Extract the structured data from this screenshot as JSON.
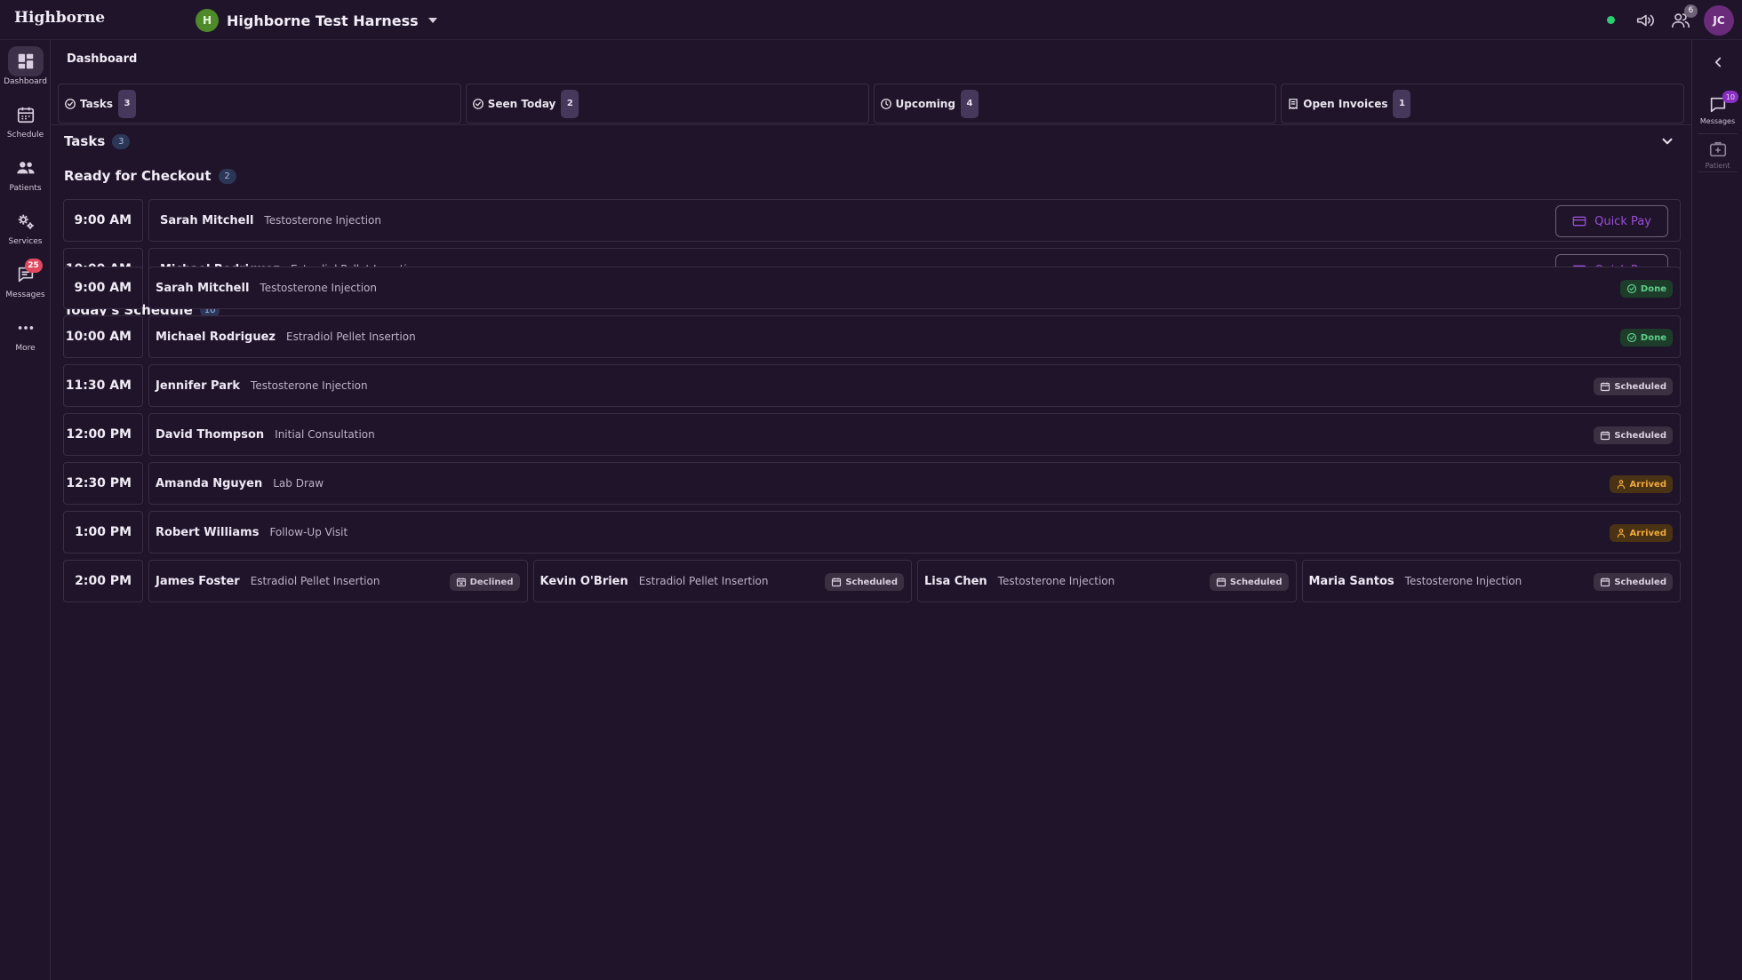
{
  "app": {
    "brand": "Highborne",
    "org_initial": "H",
    "org_name": "Highborne Test Harness",
    "user_initials": "JC",
    "notification_count": "6",
    "status_color": "#2ecc71",
    "accent_color": "#9a4fd6"
  },
  "sidebar": {
    "items": [
      {
        "label": "Dashboard",
        "icon": "dashboard-icon",
        "active": true
      },
      {
        "label": "Schedule",
        "icon": "calendar-icon"
      },
      {
        "label": "Patients",
        "icon": "users-icon"
      },
      {
        "label": "Services",
        "icon": "gears-icon"
      },
      {
        "label": "Messages",
        "icon": "chat-icon",
        "badge": "25"
      },
      {
        "label": "More",
        "icon": "more-icon"
      }
    ]
  },
  "right_rail": {
    "items": [
      {
        "label": "Messages",
        "icon": "chat-icon",
        "badge": "10"
      },
      {
        "label": "Patient",
        "icon": "patient-icon"
      }
    ]
  },
  "page": {
    "title": "Dashboard"
  },
  "stat_tabs": [
    {
      "label": "Tasks",
      "count": "3",
      "icon": "check-circle-icon"
    },
    {
      "label": "Seen Today",
      "count": "2",
      "icon": "check-circle-icon"
    },
    {
      "label": "Upcoming",
      "count": "4",
      "icon": "clock-icon"
    },
    {
      "label": "Open Invoices",
      "count": "1",
      "icon": "invoice-icon"
    }
  ],
  "tasks": {
    "title": "Tasks",
    "count": "3",
    "checkout": {
      "title": "Ready for Checkout",
      "count": "2",
      "button_label": "Quick Pay",
      "rows": [
        {
          "time": "9:00 AM",
          "name": "Sarah Mitchell",
          "service": "Testosterone Injection"
        },
        {
          "time": "10:00 AM",
          "name": "Michael Rodriguez",
          "service": "Estradiol Pellet Insertion"
        }
      ]
    }
  },
  "schedule": {
    "title": "Today's Schedule",
    "count": "10",
    "rows": [
      {
        "time": "9:00 AM",
        "appointments": [
          {
            "name": "Sarah Mitchell",
            "service": "Testosterone Injection",
            "status": "Done",
            "kind": "done"
          }
        ]
      },
      {
        "time": "10:00 AM",
        "appointments": [
          {
            "name": "Michael Rodriguez",
            "service": "Estradiol Pellet Insertion",
            "status": "Done",
            "kind": "done"
          }
        ]
      },
      {
        "time": "11:30 AM",
        "appointments": [
          {
            "name": "Jennifer Park",
            "service": "Testosterone Injection",
            "status": "Scheduled",
            "kind": "scheduled"
          }
        ]
      },
      {
        "time": "12:00 PM",
        "appointments": [
          {
            "name": "David Thompson",
            "service": "Initial Consultation",
            "status": "Scheduled",
            "kind": "scheduled"
          }
        ]
      },
      {
        "time": "12:30 PM",
        "appointments": [
          {
            "name": "Amanda Nguyen",
            "service": "Lab Draw",
            "status": "Arrived",
            "kind": "arrived"
          }
        ]
      },
      {
        "time": "1:00 PM",
        "appointments": [
          {
            "name": "Robert Williams",
            "service": "Follow-Up Visit",
            "status": "Arrived",
            "kind": "arrived"
          }
        ]
      },
      {
        "time": "2:00 PM",
        "appointments": [
          {
            "name": "James Foster",
            "service": "Estradiol Pellet Insertion",
            "status": "Declined",
            "kind": "declined"
          },
          {
            "name": "Kevin O'Brien",
            "service": "Estradiol Pellet Insertion",
            "status": "Scheduled",
            "kind": "scheduled"
          },
          {
            "name": "Lisa Chen",
            "service": "Testosterone Injection",
            "status": "Scheduled",
            "kind": "scheduled"
          },
          {
            "name": "Maria Santos",
            "service": "Testosterone Injection",
            "status": "Scheduled",
            "kind": "scheduled"
          }
        ]
      }
    ]
  }
}
